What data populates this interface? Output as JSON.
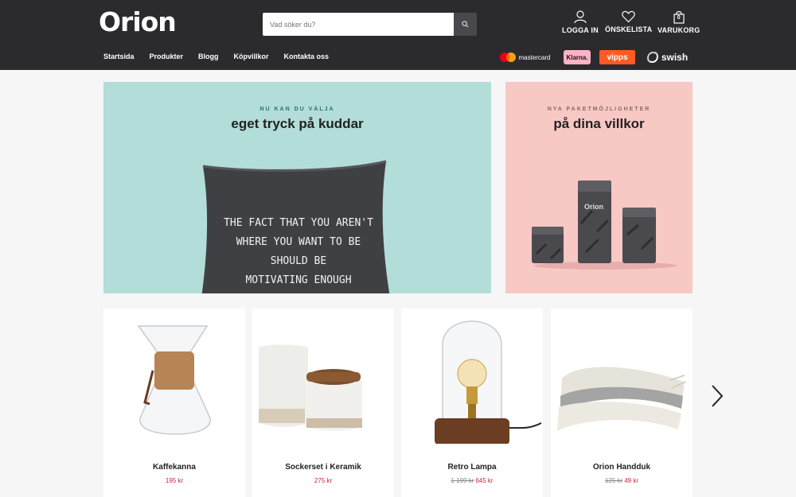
{
  "brand": {
    "logo_text": "Orion"
  },
  "search": {
    "placeholder": "Vad söker du?"
  },
  "header_actions": {
    "login": "LOGGA IN",
    "wishlist": "ÖNSKELISTA",
    "cart": "VARUKORG",
    "cart_count": "0"
  },
  "nav": [
    "Startsida",
    "Produkter",
    "Blogg",
    "Köpvillkor",
    "Kontakta oss"
  ],
  "payments": {
    "mastercard": "mastercard",
    "klarna": "Klarna.",
    "vipps": "vipps",
    "swish": "swish"
  },
  "banners": [
    {
      "kicker": "NU KAN DU VÄLJA",
      "headline": "eget tryck på kuddar",
      "pillow_text": [
        "THE FACT THAT YOU AREN'T",
        "WHERE YOU WANT TO BE",
        "SHOULD BE",
        "MOTIVATING ENOUGH"
      ]
    },
    {
      "kicker": "NYA PAKETMÖJLIGHETER",
      "headline": "på dina villkor",
      "tin_label": "Orion"
    }
  ],
  "products": [
    {
      "name": "Kaffekanna",
      "old_price": "",
      "price": "195 kr"
    },
    {
      "name": "Sockerset i Keramik",
      "old_price": "",
      "price": "275 kr"
    },
    {
      "name": "Retro Lampa",
      "old_price": "1 199 kr",
      "price": "645 kr"
    },
    {
      "name": "Orion Handduk",
      "old_price": "125 kr",
      "price": "49 kr"
    }
  ],
  "colors": {
    "header_bg": "#2b2b2f",
    "banner_mint": "#b3ddd8",
    "banner_pink": "#f8c8c5",
    "price_red": "#d0243a",
    "klarna_pink": "#ffb3c7",
    "vipps_orange": "#ff5b24"
  }
}
